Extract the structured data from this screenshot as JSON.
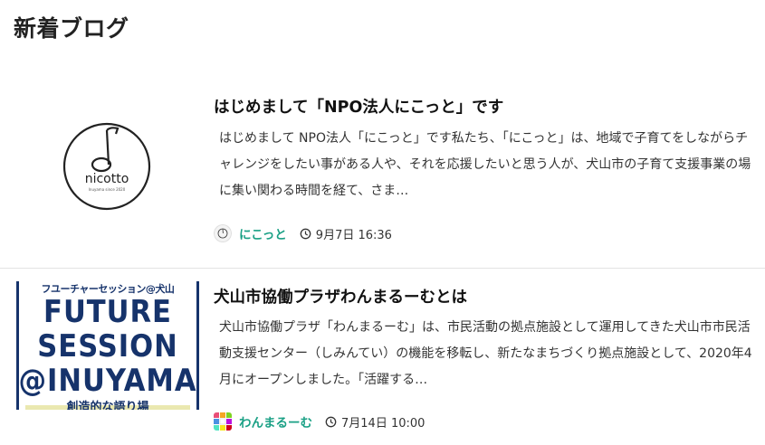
{
  "section": {
    "title": "新着ブログ"
  },
  "posts": [
    {
      "title": "はじめまして「NPO法人にこっと」です",
      "excerpt": "はじめまして NPO法人「にこっと」です私たち、「にこっと」は、地域で子育てをしながらチャレンジをしたい事がある人や、それを応援したいと思う人が、犬山市の子育て支援事業の場に集い関わる時間を経て、さま…",
      "author": "にこっと",
      "date": "9月7日 16:36",
      "thumbnail": {
        "logo_text": "nicotto",
        "logo_sub": "Inuyama since 2020"
      }
    },
    {
      "title": "犬山市協働プラザわんまるーむとは",
      "excerpt": "犬山市協働プラザ「わんまるーむ」は、市民活動の拠点施設として運用してきた犬山市市民活動支援センター（しみんてい）の機能を移転し、新たなまちづくり拠点施設として、2020年4月にオープンしました。「活躍する…",
      "author": "わんまるーむ",
      "date": "7月14日 10:00",
      "thumbnail": {
        "top_text": "フユーチャーセッション@犬山",
        "lines": [
          "FUTURE",
          "SESSION",
          "@INUYAMA"
        ],
        "bottom_text": "創造的な語り場"
      }
    }
  ],
  "colors": {
    "author": "#1aa085",
    "thumb_navy": "#16336b"
  }
}
